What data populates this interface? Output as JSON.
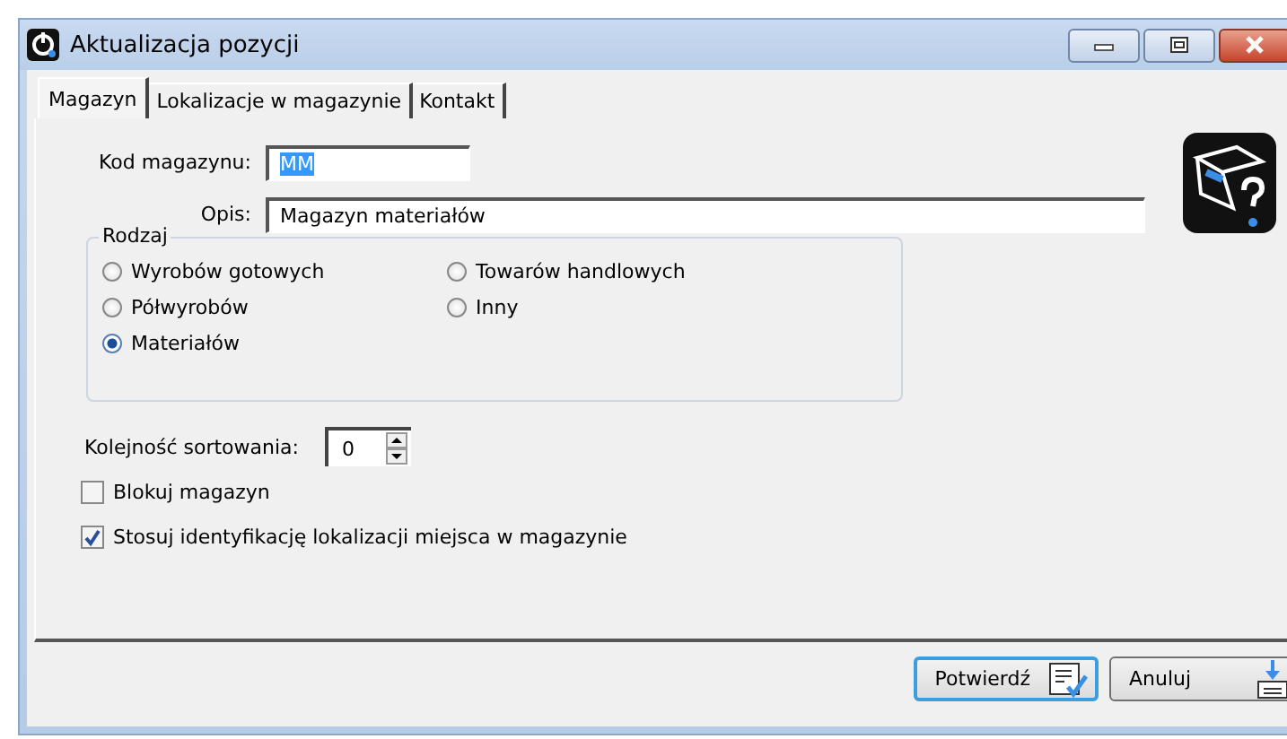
{
  "window": {
    "title": "Aktualizacja pozycji"
  },
  "tabs": [
    {
      "label": "Magazyn",
      "selected": true
    },
    {
      "label": "Lokalizacje w magazynie",
      "selected": false
    },
    {
      "label": "Kontakt",
      "selected": false
    }
  ],
  "fields": [
    {
      "label": "Kod magazynu:",
      "value": "MM",
      "highlighted": true,
      "kind": "short"
    },
    {
      "label": "Opis:",
      "value": "Magazyn materiałów",
      "highlighted": false,
      "kind": "long"
    }
  ],
  "group": {
    "title": "Rodzaj",
    "options": [
      {
        "label": "Wyrobów gotowych",
        "selected": false
      },
      {
        "label": "Towarów handlowych",
        "selected": false
      },
      {
        "label": "Półwyrobów",
        "selected": false
      },
      {
        "label": "Inny",
        "selected": false
      },
      {
        "label": "Materiałów",
        "selected": true
      }
    ]
  },
  "sort_order": {
    "label": "Kolejność sortowania:",
    "value": "0"
  },
  "checkboxes": [
    {
      "label": "Blokuj magazyn",
      "checked": false
    },
    {
      "label": "Stosuj identyfikację lokalizacji miejsca w magazynie",
      "checked": true
    }
  ],
  "buttons": [
    {
      "label": "Potwierdź",
      "kind": "confirm"
    },
    {
      "label": "Anuluj",
      "kind": "cancel"
    }
  ]
}
